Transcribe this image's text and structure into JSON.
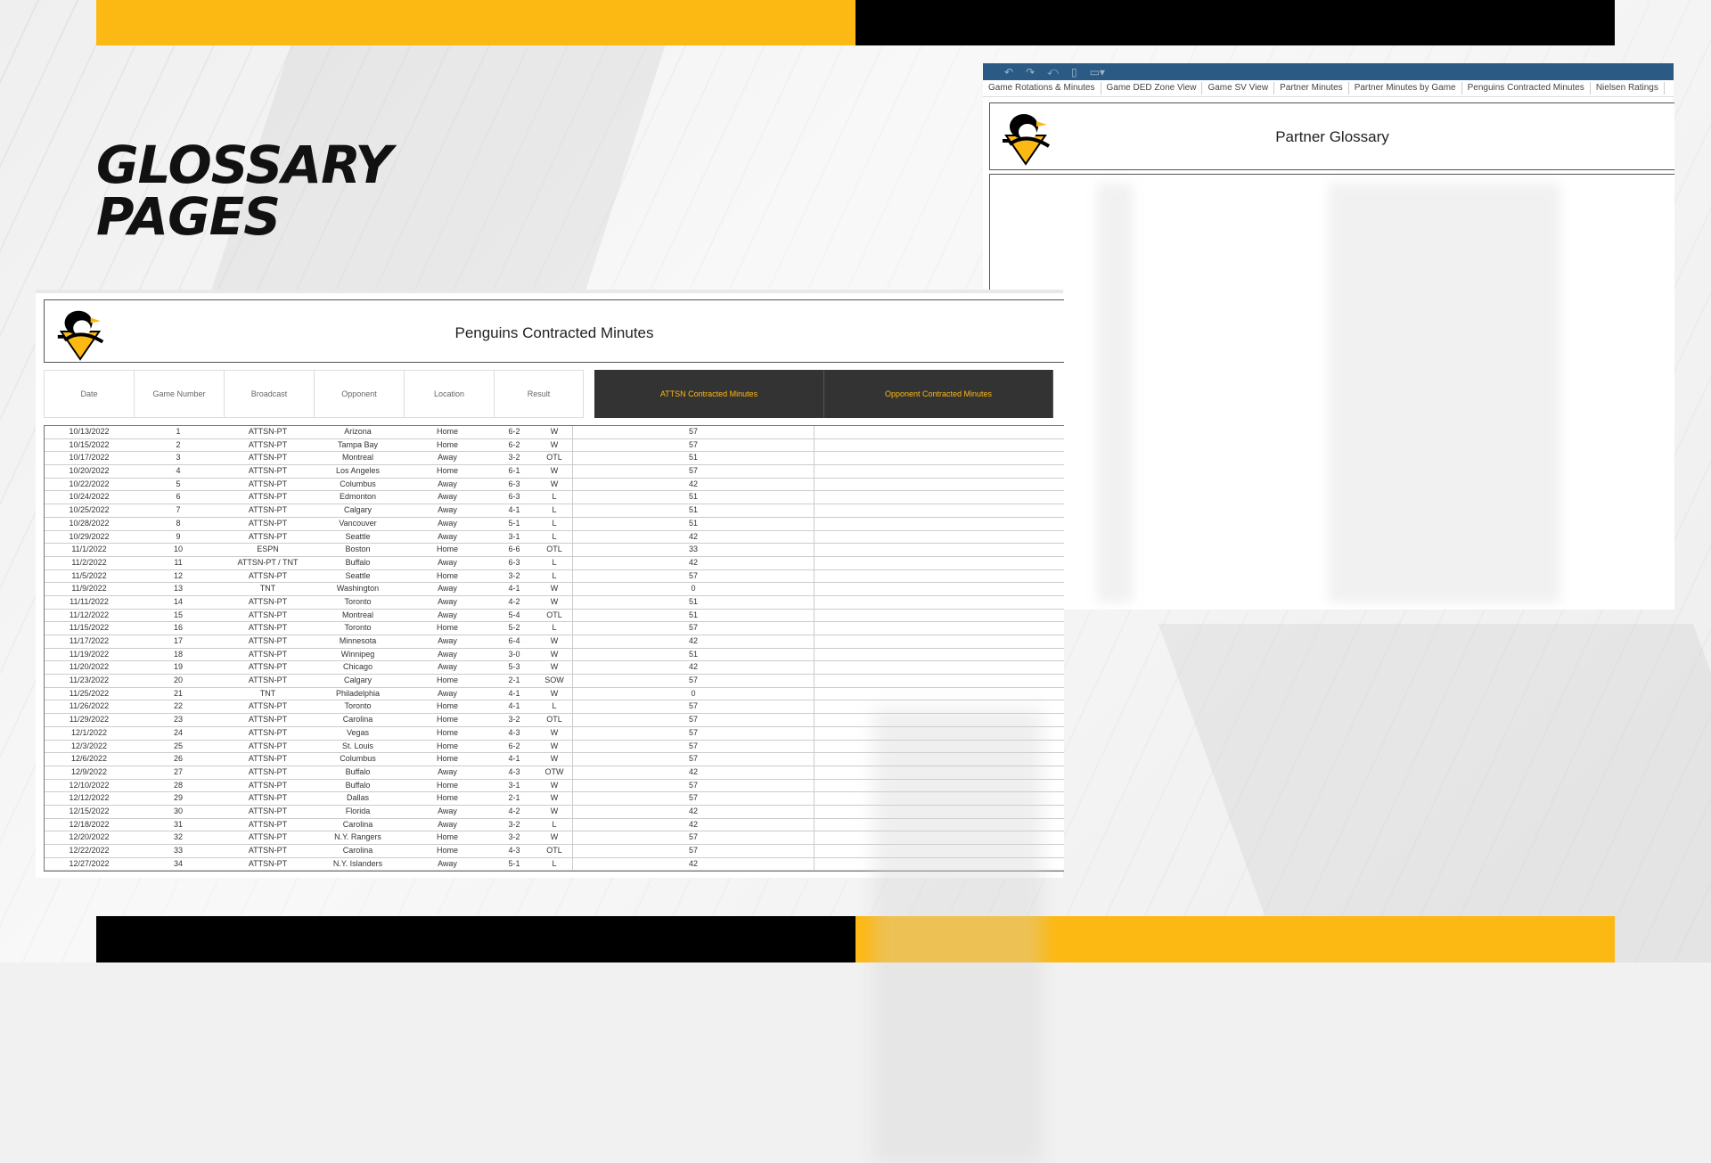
{
  "slide": {
    "title_line1": "GLOSSARY",
    "title_line2": "PAGES",
    "colors": {
      "accent_yellow": "#FDB913",
      "black": "#000000",
      "toolbar_blue": "#2b5b84",
      "header_dark": "#333333"
    }
  },
  "right_window": {
    "toolbar_icons": [
      "undo-icon",
      "redo-icon",
      "revert-icon",
      "save-icon",
      "present-icon"
    ],
    "tabs": [
      "Game Rotations & Minutes",
      "Game DED Zone View",
      "Game SV View",
      "Partner Minutes",
      "Partner Minutes by Game",
      "Penguins Contracted Minutes",
      "Nielsen Ratings"
    ],
    "title": "Partner Glossary"
  },
  "left_window": {
    "title": "Penguins Contracted Minutes",
    "columns": [
      "Date",
      "Game Number",
      "Broadcast",
      "Opponent",
      "Location",
      "Result",
      "ATTSN Contracted Minutes",
      "Opponent Contracted Minutes"
    ],
    "rows": [
      [
        "10/13/2022",
        "1",
        "ATTSN-PT",
        "Arizona",
        "Home",
        "6-2",
        "W",
        "57"
      ],
      [
        "10/15/2022",
        "2",
        "ATTSN-PT",
        "Tampa Bay",
        "Home",
        "6-2",
        "W",
        "57"
      ],
      [
        "10/17/2022",
        "3",
        "ATTSN-PT",
        "Montreal",
        "Away",
        "3-2",
        "OTL",
        "51"
      ],
      [
        "10/20/2022",
        "4",
        "ATTSN-PT",
        "Los Angeles",
        "Home",
        "6-1",
        "W",
        "57"
      ],
      [
        "10/22/2022",
        "5",
        "ATTSN-PT",
        "Columbus",
        "Away",
        "6-3",
        "W",
        "42"
      ],
      [
        "10/24/2022",
        "6",
        "ATTSN-PT",
        "Edmonton",
        "Away",
        "6-3",
        "L",
        "51"
      ],
      [
        "10/25/2022",
        "7",
        "ATTSN-PT",
        "Calgary",
        "Away",
        "4-1",
        "L",
        "51"
      ],
      [
        "10/28/2022",
        "8",
        "ATTSN-PT",
        "Vancouver",
        "Away",
        "5-1",
        "L",
        "51"
      ],
      [
        "10/29/2022",
        "9",
        "ATTSN-PT",
        "Seattle",
        "Away",
        "3-1",
        "L",
        "42"
      ],
      [
        "11/1/2022",
        "10",
        "ESPN",
        "Boston",
        "Home",
        "6-6",
        "OTL",
        "33"
      ],
      [
        "11/2/2022",
        "11",
        "ATTSN-PT / TNT",
        "Buffalo",
        "Away",
        "6-3",
        "L",
        "42"
      ],
      [
        "11/5/2022",
        "12",
        "ATTSN-PT",
        "Seattle",
        "Home",
        "3-2",
        "L",
        "57"
      ],
      [
        "11/9/2022",
        "13",
        "TNT",
        "Washington",
        "Away",
        "4-1",
        "W",
        "0"
      ],
      [
        "11/11/2022",
        "14",
        "ATTSN-PT",
        "Toronto",
        "Away",
        "4-2",
        "W",
        "51"
      ],
      [
        "11/12/2022",
        "15",
        "ATTSN-PT",
        "Montreal",
        "Away",
        "5-4",
        "OTL",
        "51"
      ],
      [
        "11/15/2022",
        "16",
        "ATTSN-PT",
        "Toronto",
        "Home",
        "5-2",
        "L",
        "57"
      ],
      [
        "11/17/2022",
        "17",
        "ATTSN-PT",
        "Minnesota",
        "Away",
        "6-4",
        "W",
        "42"
      ],
      [
        "11/19/2022",
        "18",
        "ATTSN-PT",
        "Winnipeg",
        "Away",
        "3-0",
        "W",
        "51"
      ],
      [
        "11/20/2022",
        "19",
        "ATTSN-PT",
        "Chicago",
        "Away",
        "5-3",
        "W",
        "42"
      ],
      [
        "11/23/2022",
        "20",
        "ATTSN-PT",
        "Calgary",
        "Home",
        "2-1",
        "SOW",
        "57"
      ],
      [
        "11/25/2022",
        "21",
        "TNT",
        "Philadelphia",
        "Away",
        "4-1",
        "W",
        "0"
      ],
      [
        "11/26/2022",
        "22",
        "ATTSN-PT",
        "Toronto",
        "Home",
        "4-1",
        "L",
        "57"
      ],
      [
        "11/29/2022",
        "23",
        "ATTSN-PT",
        "Carolina",
        "Home",
        "3-2",
        "OTL",
        "57"
      ],
      [
        "12/1/2022",
        "24",
        "ATTSN-PT",
        "Vegas",
        "Home",
        "4-3",
        "W",
        "57"
      ],
      [
        "12/3/2022",
        "25",
        "ATTSN-PT",
        "St. Louis",
        "Home",
        "6-2",
        "W",
        "57"
      ],
      [
        "12/6/2022",
        "26",
        "ATTSN-PT",
        "Columbus",
        "Home",
        "4-1",
        "W",
        "57"
      ],
      [
        "12/9/2022",
        "27",
        "ATTSN-PT",
        "Buffalo",
        "Away",
        "4-3",
        "OTW",
        "42"
      ],
      [
        "12/10/2022",
        "28",
        "ATTSN-PT",
        "Buffalo",
        "Home",
        "3-1",
        "W",
        "57"
      ],
      [
        "12/12/2022",
        "29",
        "ATTSN-PT",
        "Dallas",
        "Home",
        "2-1",
        "W",
        "57"
      ],
      [
        "12/15/2022",
        "30",
        "ATTSN-PT",
        "Florida",
        "Away",
        "4-2",
        "W",
        "42"
      ],
      [
        "12/18/2022",
        "31",
        "ATTSN-PT",
        "Carolina",
        "Away",
        "3-2",
        "L",
        "42"
      ],
      [
        "12/20/2022",
        "32",
        "ATTSN-PT",
        "N.Y. Rangers",
        "Home",
        "3-2",
        "W",
        "57"
      ],
      [
        "12/22/2022",
        "33",
        "ATTSN-PT",
        "Carolina",
        "Home",
        "4-3",
        "OTL",
        "57"
      ],
      [
        "12/27/2022",
        "34",
        "ATTSN-PT",
        "N.Y. Islanders",
        "Away",
        "5-1",
        "L",
        "42"
      ]
    ]
  }
}
